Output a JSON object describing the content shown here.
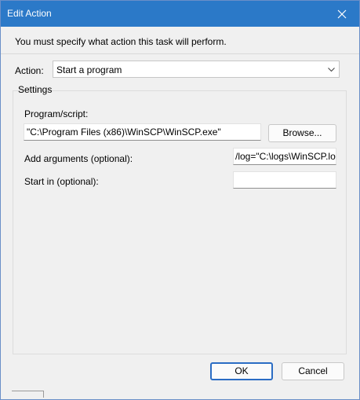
{
  "window": {
    "title": "Edit Action"
  },
  "dialog": {
    "message": "You must specify what action this task will perform.",
    "action_label": "Action:",
    "action_value": "Start a program",
    "settings_label": "Settings",
    "program_label": "Program/script:",
    "program_value": "\"C:\\Program Files (x86)\\WinSCP\\WinSCP.exe\"",
    "browse_label": "Browse...",
    "args_label": "Add arguments (optional):",
    "args_value": "/log=\"C:\\logs\\WinSCP.lo",
    "startin_label": "Start in (optional):",
    "startin_value": "",
    "ok_label": "OK",
    "cancel_label": "Cancel"
  },
  "icons": {
    "close": "close-icon",
    "dropdown": "chevron-down-icon"
  },
  "colors": {
    "titlebar": "#2b79c8",
    "ok_border": "#2b6dc4"
  }
}
